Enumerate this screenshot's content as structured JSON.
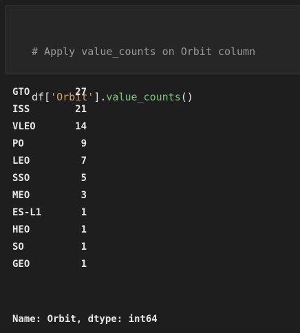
{
  "cell": {
    "code_comment": "# Apply value_counts on Orbit column",
    "code_var": "df[",
    "code_string": "'Orbit'",
    "code_mid": "].",
    "code_func": "value_counts",
    "code_end": "()"
  },
  "output": {
    "rows": [
      {
        "label": "GTO",
        "count": "27"
      },
      {
        "label": "ISS",
        "count": "21"
      },
      {
        "label": "VLEO",
        "count": "14"
      },
      {
        "label": "PO",
        "count": "9"
      },
      {
        "label": "LEO",
        "count": "7"
      },
      {
        "label": "SSO",
        "count": "5"
      },
      {
        "label": "MEO",
        "count": "3"
      },
      {
        "label": "ES-L1",
        "count": "1"
      },
      {
        "label": "HEO",
        "count": "1"
      },
      {
        "label": "SO",
        "count": "1"
      },
      {
        "label": "GEO",
        "count": "1"
      }
    ],
    "footer": "Name: Orbit, dtype: int64"
  }
}
